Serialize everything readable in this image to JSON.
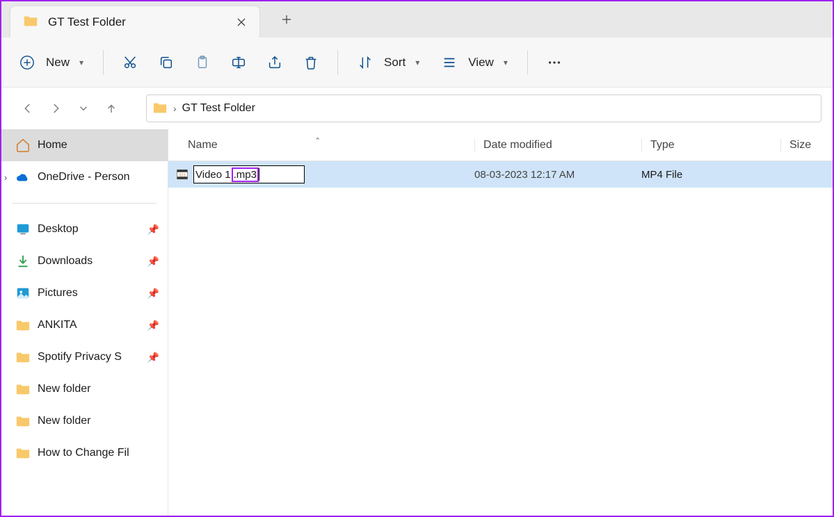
{
  "tab": {
    "title": "GT Test Folder"
  },
  "toolbar": {
    "new_label": "New",
    "sort_label": "Sort",
    "view_label": "View"
  },
  "breadcrumb": {
    "folder": "GT Test Folder"
  },
  "sidebar": {
    "home": "Home",
    "onedrive": "OneDrive - Person",
    "quick": [
      {
        "label": "Desktop",
        "icon": "desktop",
        "pinned": true
      },
      {
        "label": "Downloads",
        "icon": "downloads",
        "pinned": true
      },
      {
        "label": "Pictures",
        "icon": "pictures",
        "pinned": true
      },
      {
        "label": "ANKITA",
        "icon": "folder",
        "pinned": true
      },
      {
        "label": "Spotify Privacy S",
        "icon": "folder",
        "pinned": true
      },
      {
        "label": "New folder",
        "icon": "folder",
        "pinned": false
      },
      {
        "label": "New folder",
        "icon": "folder",
        "pinned": false
      },
      {
        "label": "How to Change Fil",
        "icon": "folder",
        "pinned": false
      }
    ]
  },
  "columns": {
    "name": "Name",
    "date": "Date modified",
    "type": "Type",
    "size": "Size"
  },
  "file": {
    "rename_base": "Video 1",
    "rename_ext_selected": ".mp3",
    "date": "08-03-2023 12:17 AM",
    "type": "MP4 File"
  }
}
